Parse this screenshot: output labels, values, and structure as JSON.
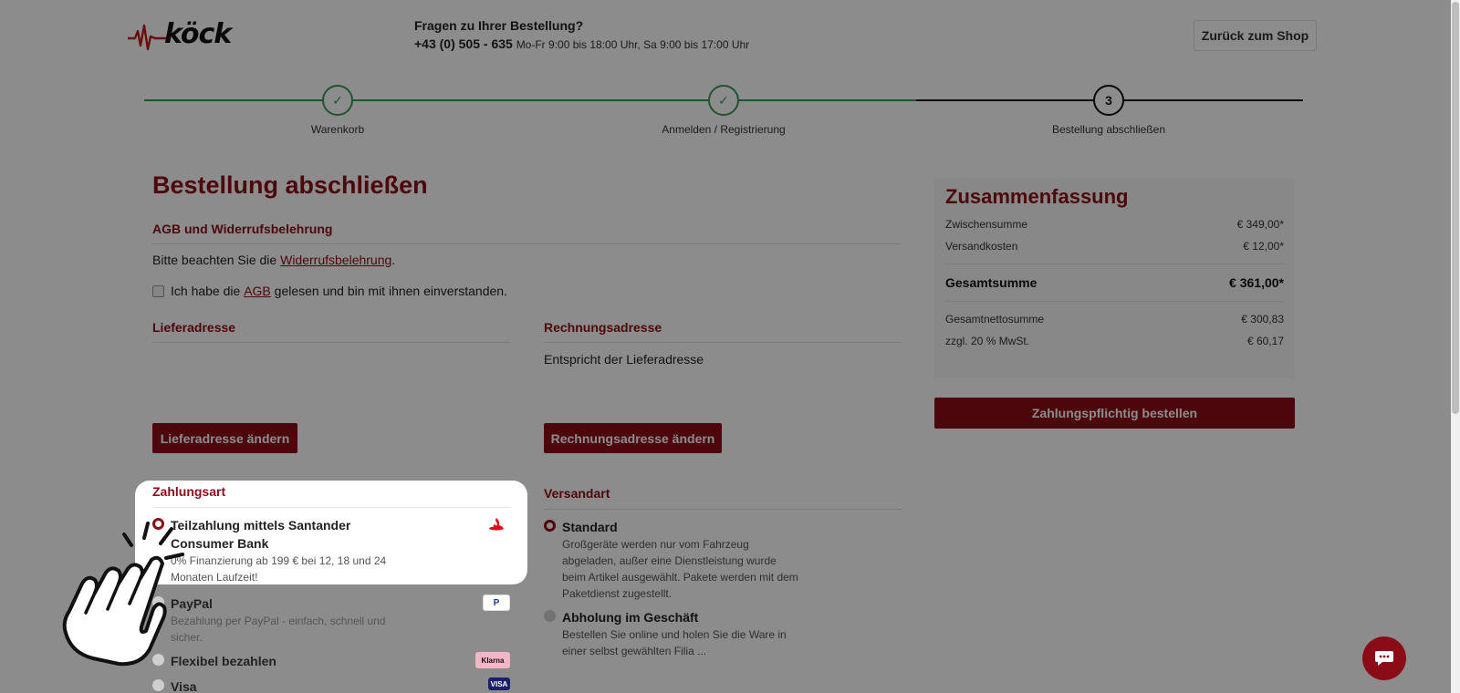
{
  "header": {
    "logo_text": "köck",
    "help_question": "Fragen zu Ihrer Bestellung?",
    "phone": "+43 (0) 505 - 635",
    "hours": "Mo-Fr 9:00 bis 18:00 Uhr, Sa 9:00 bis 17:00 Uhr",
    "back_button": "Zurück zum Shop"
  },
  "stepper": {
    "steps": [
      {
        "label": "Warenkorb",
        "mark": "✓",
        "state": "done"
      },
      {
        "label": "Anmelden / Registrierung",
        "mark": "✓",
        "state": "done"
      },
      {
        "label": "Bestellung abschließen",
        "mark": "3",
        "state": "active"
      }
    ]
  },
  "main": {
    "title": "Bestellung abschließen",
    "agb": {
      "heading": "AGB und Widerrufsbelehrung",
      "notice_prefix": "Bitte beachten Sie die",
      "notice_link": "Widerrufsbelehrung",
      "notice_suffix": ".",
      "checkbox_prefix": "Ich habe die",
      "checkbox_link": "AGB",
      "checkbox_suffix": "gelesen und bin mit ihnen einverstanden."
    },
    "lieferadresse": {
      "heading": "Lieferadresse",
      "button": "Lieferadresse ändern"
    },
    "rechnungsadresse": {
      "heading": "Rechnungsadresse",
      "text": "Entspricht der Lieferadresse",
      "button": "Rechnungsadresse ändern"
    },
    "zahlungsart": {
      "heading": "Zahlungsart",
      "options": [
        {
          "title": "Teilzahlung mittels Santander Consumer Bank",
          "desc": "0% Finanzierung ab 199 € bei 12, 18 und 24 Monaten Laufzeit!",
          "selected": true,
          "logo": "santander-flame-icon"
        },
        {
          "title": "PayPal",
          "desc": "Bezahlung per PayPal - einfach, schnell und sicher.",
          "selected": false,
          "logo_text": "P"
        },
        {
          "title": "Flexibel bezahlen",
          "desc": "",
          "selected": false,
          "logo_text": "Klarna"
        },
        {
          "title": "Visa",
          "desc": "",
          "selected": false,
          "logo_text": "VISA"
        }
      ]
    },
    "versandart": {
      "heading": "Versandart",
      "options": [
        {
          "title": "Standard",
          "desc": "Großgeräte werden nur vom Fahrzeug abgeladen, außer eine Dienstleistung wurde beim Artikel ausgewählt. Pakete werden mit dem Paketdienst zugestellt.",
          "selected": true
        },
        {
          "title": "Abholung im Geschäft",
          "desc": "Bestellen Sie online und holen Sie die Ware in einer selbst gewählten Filia ...",
          "selected": false
        }
      ]
    }
  },
  "summary": {
    "title": "Zusammenfassung",
    "rows": [
      {
        "label": "Zwischensumme",
        "value": "€ 349,00*"
      },
      {
        "label": "Versandkosten",
        "value": "€ 12,00*"
      }
    ],
    "total": {
      "label": "Gesamtsumme",
      "value": "€ 361,00*"
    },
    "net_rows": [
      {
        "label": "Gesamtnettosumme",
        "value": "€ 300,83"
      },
      {
        "label": "zzgl. 20 % MwSt.",
        "value": "€ 60,17"
      }
    ],
    "order_button": "Zahlungspflichtig bestellen"
  },
  "colors": {
    "brand_red": "#8b0c16",
    "step_done": "#3a9a5b",
    "overlay": "rgba(0,0,0,0.45)"
  }
}
